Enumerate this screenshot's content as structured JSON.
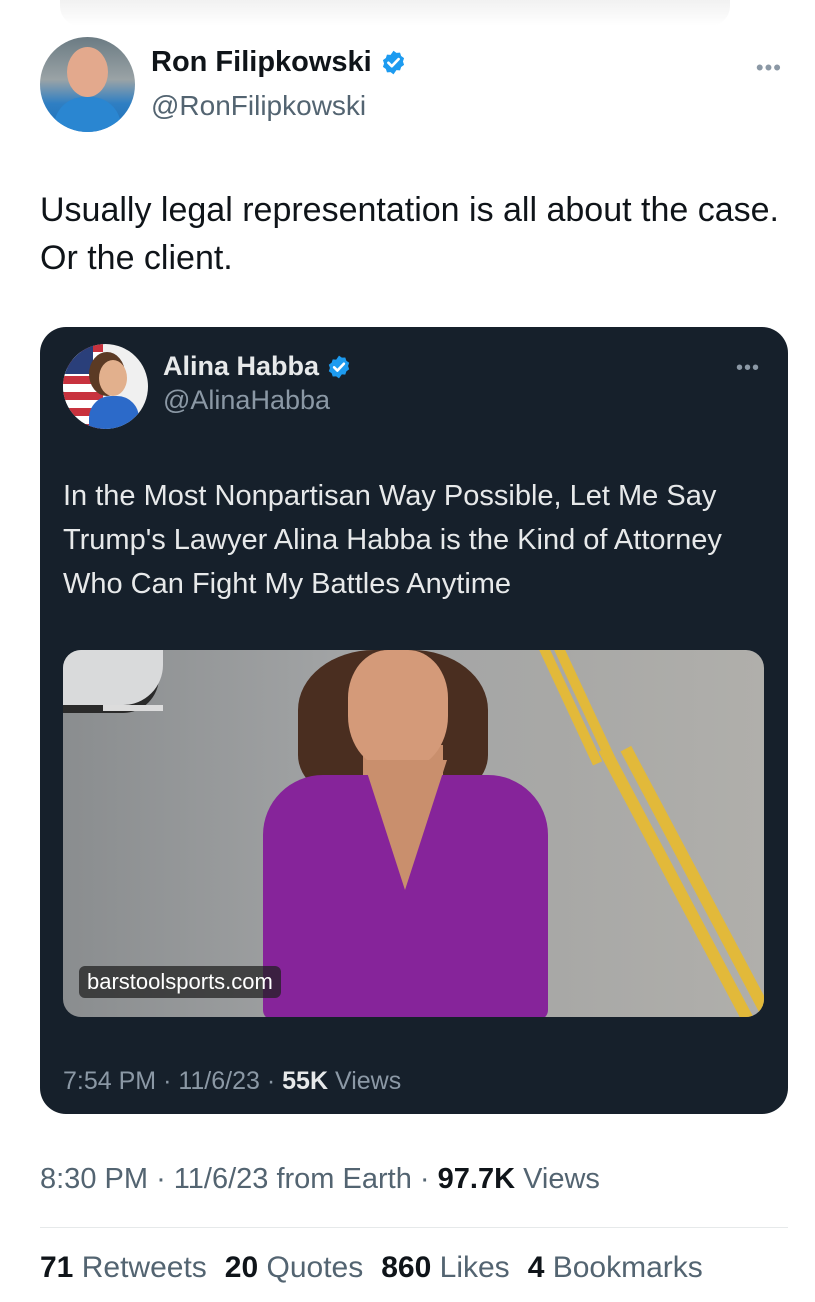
{
  "author": {
    "name": "Ron Filipkowski",
    "handle": "@RonFilipkowski",
    "verified_color": "#1d9bf0"
  },
  "more_icon": "•••",
  "tweet": {
    "text": "Usually legal representation is all about the case. Or the client.",
    "time": "8:30 PM",
    "date": "11/6/23",
    "source": "from Earth",
    "views_count": "97.7K",
    "views_label": "Views"
  },
  "quote": {
    "author_name": "Alina Habba",
    "author_handle": "@AlinaHabba",
    "text": "In the Most Nonpartisan Way Possible, Let Me Say Trump's Lawyer Alina Habba is the Kind of Attorney Who Can Fight My Battles Anytime",
    "media_source": "barstoolsports.com",
    "time": "7:54 PM",
    "date": "11/6/23",
    "views_count": "55K",
    "views_label": "Views"
  },
  "stats": {
    "retweets_count": "71",
    "retweets_label": "Retweets",
    "quotes_count": "20",
    "quotes_label": "Quotes",
    "likes_count": "860",
    "likes_label": "Likes",
    "bookmarks_count": "4",
    "bookmarks_label": "Bookmarks"
  },
  "separator": "·"
}
